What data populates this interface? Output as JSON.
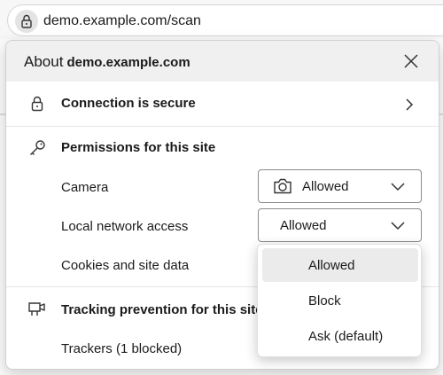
{
  "address_bar": {
    "url": "demo.example.com/scan"
  },
  "popup": {
    "title_prefix": "About",
    "title_domain": "demo.example.com",
    "connection_label": "Connection is secure",
    "permissions_heading": "Permissions for this site",
    "permissions": [
      {
        "label": "Camera",
        "value": "Allowed",
        "has_icon": true
      },
      {
        "label": "Local network access",
        "value": "Allowed",
        "has_icon": false
      },
      {
        "label": "Cookies and site data"
      }
    ],
    "tracking_heading": "Tracking prevention for this site",
    "trackers_label": "Trackers (1 blocked)"
  },
  "dropdown": {
    "options": [
      "Allowed",
      "Block",
      "Ask (default)"
    ],
    "selected": "Allowed"
  }
}
